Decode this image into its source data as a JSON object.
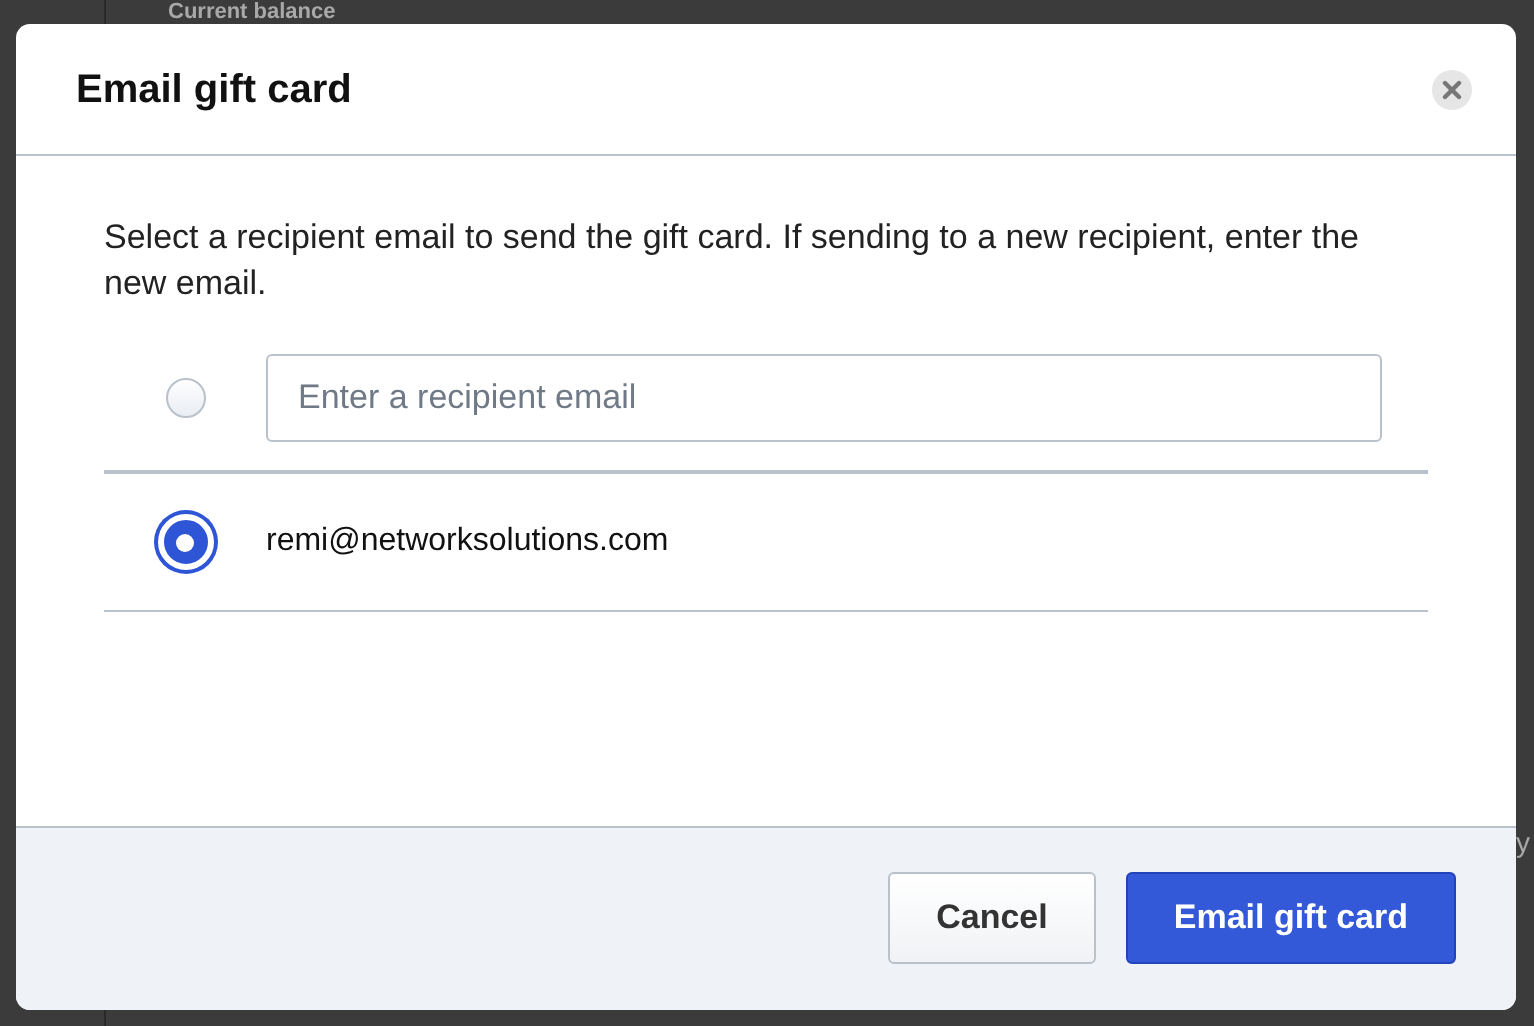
{
  "background": {
    "heading": "Current balance",
    "side_text": "y"
  },
  "dialog": {
    "title": "Email gift card",
    "instructions": "Select a recipient email to send the gift card. If sending to a new recipient, enter the new email.",
    "options": [
      {
        "kind": "input",
        "selected": false,
        "placeholder": "Enter a recipient email"
      },
      {
        "kind": "email",
        "selected": true,
        "label": "remi@networksolutions.com"
      }
    ],
    "buttons": [
      {
        "label": "Cancel",
        "kind": "secondary"
      },
      {
        "label": "Email gift card",
        "kind": "primary"
      }
    ]
  }
}
